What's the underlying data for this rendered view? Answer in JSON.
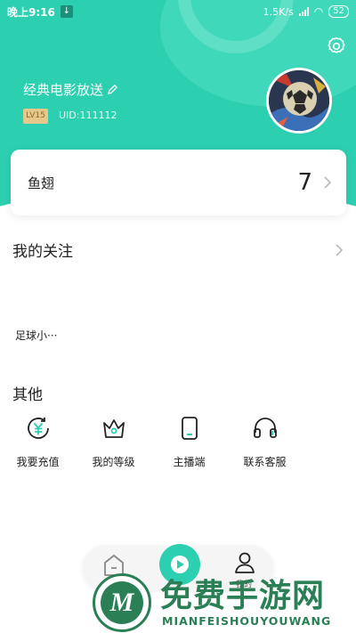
{
  "status_bar": {
    "time": "晚上9:16",
    "network_speed": "1.5K/s",
    "battery": "52"
  },
  "profile": {
    "username": "经典电影放送",
    "level": "LV15",
    "uid": "UID:111112"
  },
  "wallet_card": {
    "label": "鱼翅",
    "value": "7"
  },
  "follow_section": {
    "title": "我的关注",
    "items": [
      "足球小···"
    ]
  },
  "other_section": {
    "title": "其他",
    "items": [
      {
        "label": "我要充值",
        "icon": "recharge-icon"
      },
      {
        "label": "我的等级",
        "icon": "crown-icon"
      },
      {
        "label": "主播端",
        "icon": "phone-icon"
      },
      {
        "label": "联系客服",
        "icon": "headset-icon"
      }
    ]
  },
  "tabbar": {
    "me_label": "我的"
  },
  "watermark": {
    "chinese": "免费手游网",
    "english": "MIANFEISHOUYOUWANG",
    "logo_letter": "M"
  },
  "colors": {
    "accent": "#2ccfb0",
    "watermark": "#2a7f55",
    "level_badge": "#e8c88a"
  }
}
